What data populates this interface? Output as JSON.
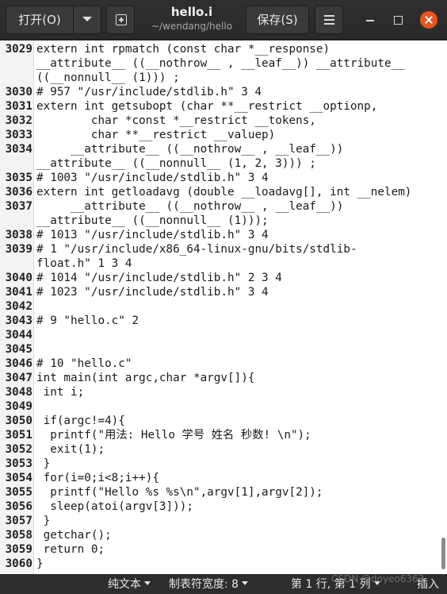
{
  "window": {
    "title": "hello.i",
    "subtitle": "~/wendang/hello"
  },
  "toolbar": {
    "open_label": "打开(O)",
    "save_label": "保存(S)"
  },
  "icons": {
    "open_dropdown": "chevron-down-icon",
    "new_document": "new-document-icon",
    "menu": "hamburger-menu-icon",
    "minimize": "minimize-icon",
    "maximize": "maximize-icon",
    "close": "close-icon",
    "close_color": "#e95420"
  },
  "editor": {
    "lines": [
      {
        "n": "3029",
        "t": "extern int rpmatch (const char *__response)"
      },
      {
        "n": "",
        "t": "__attribute__ ((__nothrow__ , __leaf__)) __attribute__"
      },
      {
        "n": "",
        "t": "((__nonnull__ (1))) ;"
      },
      {
        "n": "3030",
        "t": "# 957 \"/usr/include/stdlib.h\" 3 4"
      },
      {
        "n": "3031",
        "t": "extern int getsubopt (char **__restrict __optionp,"
      },
      {
        "n": "3032",
        "t": "        char *const *__restrict __tokens,"
      },
      {
        "n": "3033",
        "t": "        char **__restrict __valuep)"
      },
      {
        "n": "3034",
        "t": "     __attribute__ ((__nothrow__ , __leaf__))"
      },
      {
        "n": "",
        "t": "__attribute__ ((__nonnull__ (1, 2, 3))) ;"
      },
      {
        "n": "3035",
        "t": "# 1003 \"/usr/include/stdlib.h\" 3 4"
      },
      {
        "n": "3036",
        "t": "extern int getloadavg (double __loadavg[], int __nelem)"
      },
      {
        "n": "3037",
        "t": "     __attribute__ ((__nothrow__ , __leaf__))"
      },
      {
        "n": "",
        "t": "__attribute__ ((__nonnull__ (1)));"
      },
      {
        "n": "3038",
        "t": "# 1013 \"/usr/include/stdlib.h\" 3 4"
      },
      {
        "n": "3039",
        "t": "# 1 \"/usr/include/x86_64-linux-gnu/bits/stdlib-"
      },
      {
        "n": "",
        "t": "float.h\" 1 3 4"
      },
      {
        "n": "3040",
        "t": "# 1014 \"/usr/include/stdlib.h\" 2 3 4"
      },
      {
        "n": "3041",
        "t": "# 1023 \"/usr/include/stdlib.h\" 3 4"
      },
      {
        "n": "3042",
        "t": ""
      },
      {
        "n": "3043",
        "t": "# 9 \"hello.c\" 2"
      },
      {
        "n": "3044",
        "t": ""
      },
      {
        "n": "3045",
        "t": ""
      },
      {
        "n": "3046",
        "t": "# 10 \"hello.c\""
      },
      {
        "n": "3047",
        "t": "int main(int argc,char *argv[]){"
      },
      {
        "n": "3048",
        "t": " int i;"
      },
      {
        "n": "3049",
        "t": ""
      },
      {
        "n": "3050",
        "t": " if(argc!=4){"
      },
      {
        "n": "3051",
        "t": "  printf(\"用法: Hello 学号 姓名 秒数! \\n\");"
      },
      {
        "n": "3052",
        "t": "  exit(1);"
      },
      {
        "n": "3053",
        "t": " }"
      },
      {
        "n": "3054",
        "t": " for(i=0;i<8;i++){"
      },
      {
        "n": "3055",
        "t": "  printf(\"Hello %s %s\\n\",argv[1],argv[2]);"
      },
      {
        "n": "3056",
        "t": "  sleep(atoi(argv[3]));"
      },
      {
        "n": "3057",
        "t": " }"
      },
      {
        "n": "3058",
        "t": " getchar();"
      },
      {
        "n": "3059",
        "t": " return 0;"
      },
      {
        "n": "3060",
        "t": "}"
      }
    ]
  },
  "statusbar": {
    "language": "纯文本",
    "tab_width": "制表符宽度: 8",
    "position": "第 1 行, 第 1 列",
    "mode": "插入"
  },
  "watermark": "CSDN @doyeo6363"
}
